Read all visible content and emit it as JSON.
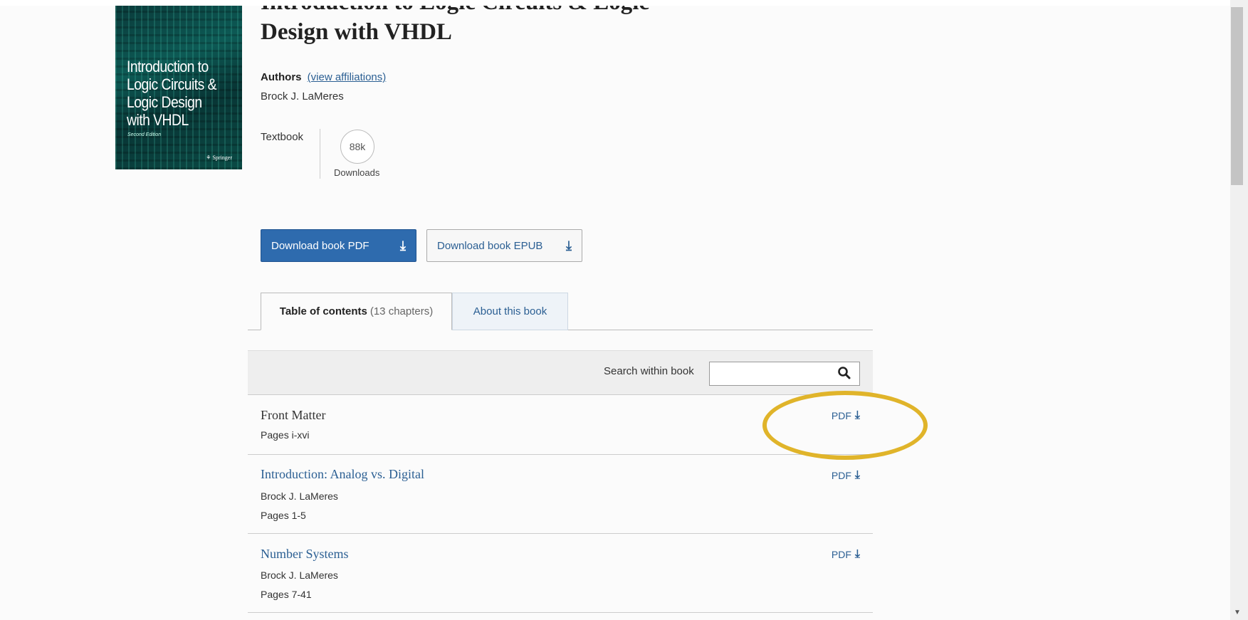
{
  "book": {
    "title": "Introduction to Logic Circuits & Logic Design with VHDL",
    "authors_label": "Authors",
    "affiliations_link": "(view affiliations)",
    "author": "Brock J. LaMeres",
    "type": "Textbook",
    "downloads_count": "88k",
    "downloads_label": "Downloads"
  },
  "cover": {
    "title": "Introduction to Logic Circuits & Logic Design with VHDL",
    "edition": "Second Edition",
    "publisher": "Springer"
  },
  "buttons": {
    "pdf": "Download book PDF",
    "epub": "Download book EPUB"
  },
  "tabs": {
    "toc_bold": "Table of contents",
    "toc_count": "(13 chapters)",
    "about": "About this book"
  },
  "search": {
    "label": "Search within book",
    "value": ""
  },
  "chapters": [
    {
      "title": "Front Matter",
      "author": "",
      "pages": "Pages i-xvi",
      "pdf": "PDF"
    },
    {
      "title": "Introduction: Analog vs. Digital",
      "author": "Brock J. LaMeres",
      "pages": "Pages 1-5",
      "pdf": "PDF"
    },
    {
      "title": "Number Systems",
      "author": "Brock J. LaMeres",
      "pages": "Pages 7-41",
      "pdf": "PDF"
    }
  ],
  "colors": {
    "primary": "#2e6bae",
    "link": "#2b5f93",
    "highlight": "#e0b42a"
  }
}
